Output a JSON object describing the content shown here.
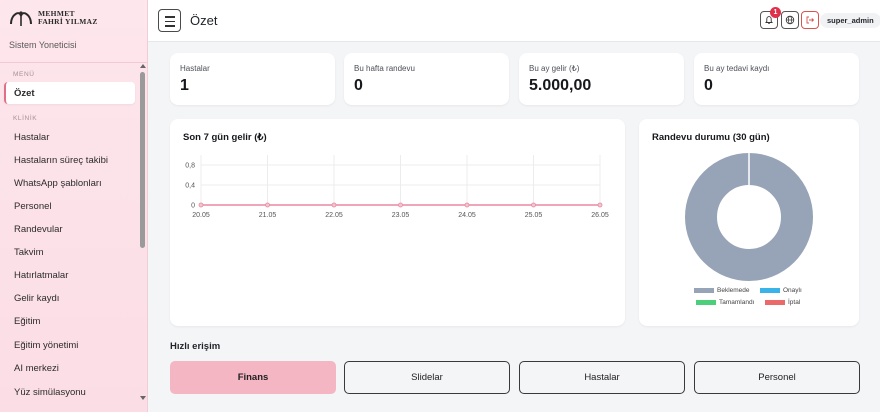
{
  "brand": {
    "line1": "MEHMET",
    "line2": "FAHRİ YILMAZ",
    "role": "Sistem Yoneticisi"
  },
  "sidebar": {
    "section_menu": "MENÜ",
    "section_clinic": "KLİNİK",
    "active_item": "Özet",
    "items": [
      "Hastalar",
      "Hastaların süreç takibi",
      "WhatsApp şablonları",
      "Personel",
      "Randevular",
      "Takvim",
      "Hatırlatmalar",
      "Gelir kaydı",
      "Eğitim",
      "Eğitim yönetimi",
      "AI merkezi",
      "Yüz simülasyonu"
    ]
  },
  "topbar": {
    "title": "Özet",
    "notification_count": "1",
    "user": "super_admin",
    "icons": [
      "bell-icon",
      "globe-icon",
      "logout-icon"
    ]
  },
  "stats": [
    {
      "label": "Hastalar",
      "value": "1"
    },
    {
      "label": "Bu hafta randevu",
      "value": "0"
    },
    {
      "label": "Bu ay gelir (₺)",
      "value": "5.000,00"
    },
    {
      "label": "Bu ay tedavi kaydı",
      "value": "0"
    }
  ],
  "chart_data": [
    {
      "type": "line",
      "title": "Son 7 gün gelir (₺)",
      "categories": [
        "20.05",
        "21.05",
        "22.05",
        "23.05",
        "24.05",
        "25.05",
        "26.05"
      ],
      "values": [
        0,
        0,
        0,
        0,
        0,
        0,
        0
      ],
      "yticks": [
        "0",
        "0,4",
        "0,8"
      ],
      "ylim": [
        0,
        1
      ],
      "grid": true,
      "color": "#e889a0"
    },
    {
      "type": "pie",
      "title": "Randevu durumu (30 gün)",
      "labels": [
        "Beklemede",
        "Onaylı",
        "Tamamlandı",
        "İptal"
      ],
      "values": [
        1,
        0,
        0,
        0
      ],
      "colors": [
        "#97a3b6",
        "#3ab4e8",
        "#4ccf7a",
        "#ea6a6a"
      ],
      "legend": "bottom"
    }
  ],
  "quick_access": {
    "title": "Hızlı erişim",
    "buttons": [
      "Finans",
      "Slidelar",
      "Hastalar",
      "Personel"
    ]
  }
}
